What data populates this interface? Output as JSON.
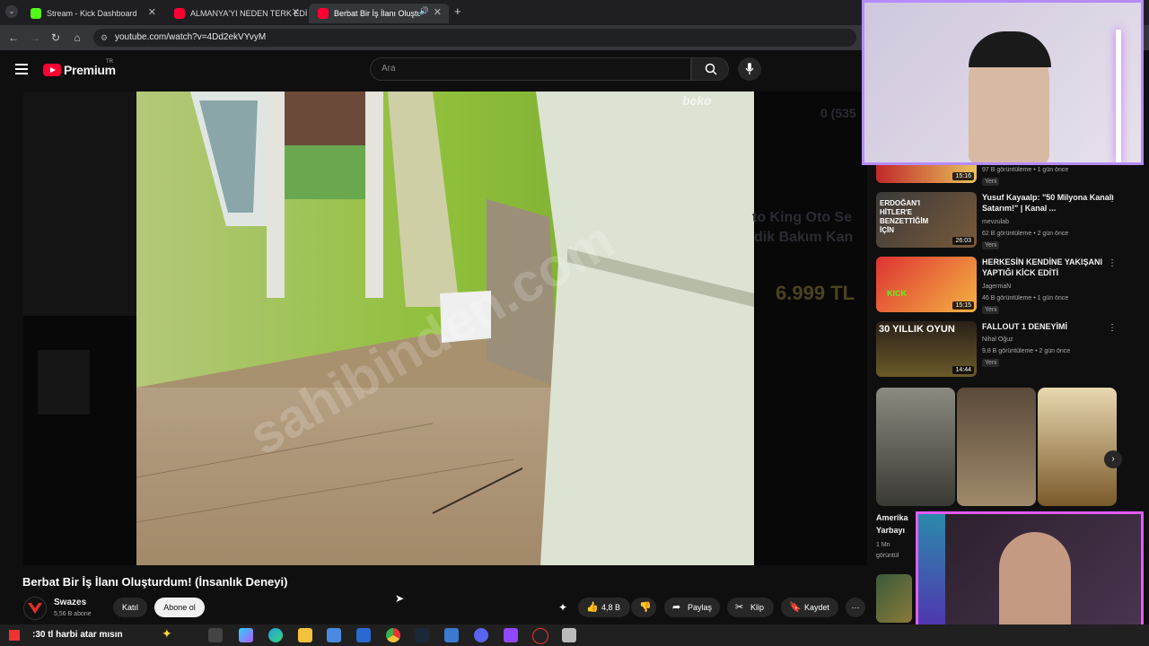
{
  "browser": {
    "tabs": [
      {
        "title": "Stream - Kick Dashboard",
        "color": "#53fc18"
      },
      {
        "title": "ALMANYA'YI NEDEN TERK EDİ",
        "color": "#ff0033"
      },
      {
        "title": "Berbat Bir İş İlanı Oluşturdu",
        "color": "#ff0033"
      }
    ],
    "url": "youtube.com/watch?v=4Dd2ekVYvyM"
  },
  "header": {
    "logo": "Premium",
    "country": "TR",
    "search_placeholder": "Ara"
  },
  "video": {
    "watermark": "sahibinden.com",
    "brand_mark": "beko",
    "title": "Berbat Bir İş İlanı Oluşturdum! (İnsanlık Deneyi)",
    "channel": "Swazes",
    "subscribers": "5,56 B abone",
    "join_label": "Katıl",
    "subscribe_label": "Abone ol",
    "likes": "4,8 B",
    "share_label": "Paylaş",
    "clip_label": "Klip",
    "save_label": "Kaydet"
  },
  "sidebar": {
    "items": [
      {
        "title": "",
        "channel": "",
        "meta": "97 B görüntüleme • 1 gün önce",
        "badge": "Yeni",
        "duration": "15:16"
      },
      {
        "title": "Yusuf Kayaalp: \"50 Milyona Kanalı Satarım!\" | Kanal ...",
        "channel": "mevzulab",
        "meta": "62 B görüntüleme • 2 gün önce",
        "badge": "Yeni",
        "duration": "26:03",
        "thumb_text": "ERDOĞAN'I HİTLER'E BENZETTİĞİM İÇİN"
      },
      {
        "title": "HERKESİN KENDİNE YAKIŞANI YAPTIĞI KİCK EDİTİ",
        "channel": "JagermaN",
        "meta": "46 B görüntüleme • 1 gün önce",
        "badge": "Yeni",
        "duration": "15:15",
        "thumb_text": "KICK"
      },
      {
        "title": "FALLOUT 1 DENEYİMİ",
        "channel": "Nihal Oğuz",
        "meta": "9,8 B görüntüleme • 2 gün önce",
        "badge": "Yeni",
        "duration": "14:44",
        "thumb_text": "30 YILLIK OYUN"
      }
    ],
    "cut_title": "Amerika Yarbayı",
    "cut_meta": "1 Mn görüntül"
  },
  "taskbar": {
    "search_text": ":30 tl harbi atar mısın"
  },
  "colors": {
    "accent": "#ff0033",
    "cam_border_top": "#b58cff",
    "cam_border_bottom": "#e25cff"
  }
}
